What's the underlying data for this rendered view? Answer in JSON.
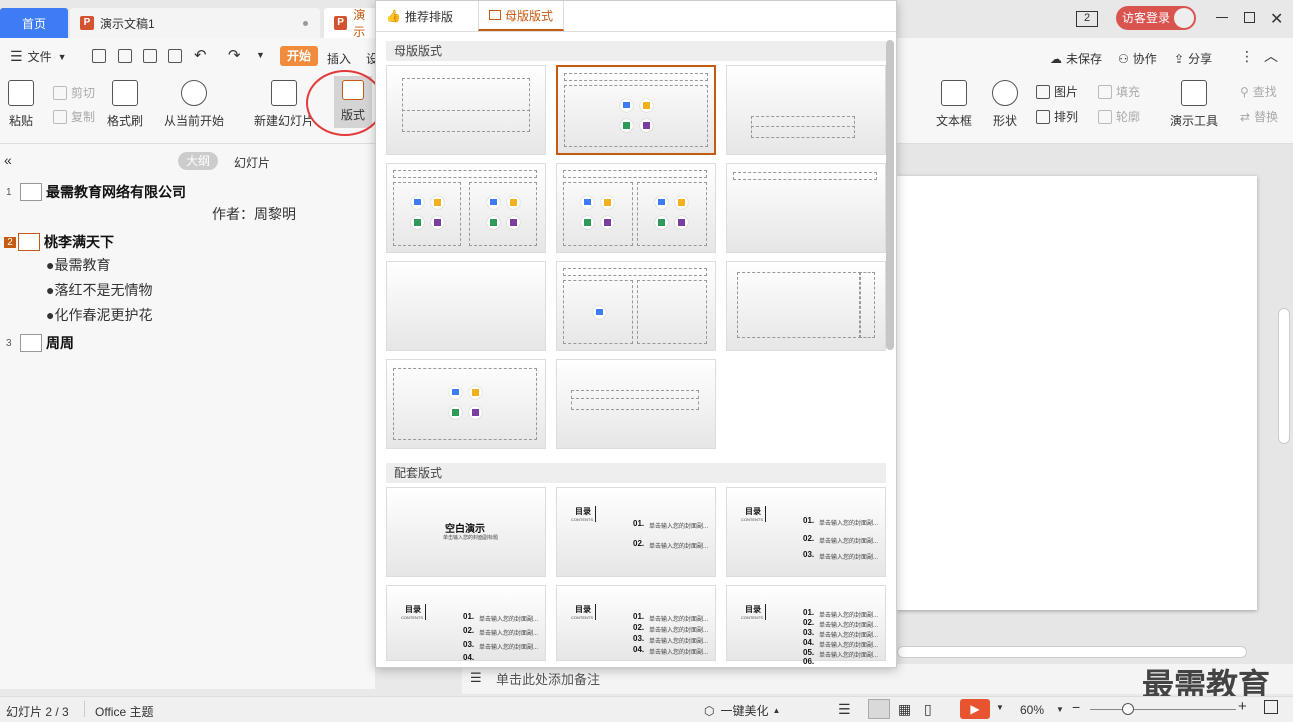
{
  "titlebar": {
    "home_tab": "首页",
    "doc_tab": "演示文稿1",
    "doc_tab2": "演示",
    "pages_badge": "2",
    "login": "访客登录"
  },
  "menubar": {
    "file": "文件",
    "start": "开始",
    "insert": "插入",
    "design": "设",
    "unsaved": "未保存",
    "collab": "协作",
    "share": "分享"
  },
  "ribbon": {
    "paste": "粘贴",
    "cut": "剪切",
    "copy": "复制",
    "format_painter": "格式刷",
    "from_current": "从当前开始",
    "new_slide": "新建幻灯片",
    "layout": "版式",
    "textbox": "文本框",
    "shape": "形状",
    "picture": "图片",
    "fill": "填充",
    "arrange": "排列",
    "outline": "轮廓",
    "presenter_tools": "演示工具",
    "find": "查找",
    "replace": "替换"
  },
  "leftpane": {
    "tab_outline": "大纲",
    "tab_slides": "幻灯片",
    "slides": [
      {
        "num": "1",
        "title": "最需教育网络有限公司",
        "subtitle": "作者：周黎明"
      },
      {
        "num": "2",
        "title": "桃李满天下",
        "bullets": [
          "最需教育",
          "落红不是无情物",
          "化作春泥更护花"
        ]
      },
      {
        "num": "3",
        "title": "周周"
      }
    ]
  },
  "popup": {
    "tab_recommend": "推荐排版",
    "tab_master": "母版版式",
    "section_master": "母版版式",
    "section_matching": "配套版式",
    "blank_title": "空白演示",
    "blank_sub": "单击输入您的封面副标题",
    "toc": "目录",
    "contents": "CONTENTS",
    "items": [
      "01.",
      "02.",
      "03.",
      "04.",
      "05.",
      "06."
    ],
    "item_text": "单击输入您的封面副..."
  },
  "notes": {
    "placeholder": "单击此处添加备注"
  },
  "status": {
    "slide": "幻灯片 2 / 3",
    "theme": "Office 主题",
    "beautify": "一键美化",
    "zoom": "60%"
  },
  "watermark": "最需教育"
}
